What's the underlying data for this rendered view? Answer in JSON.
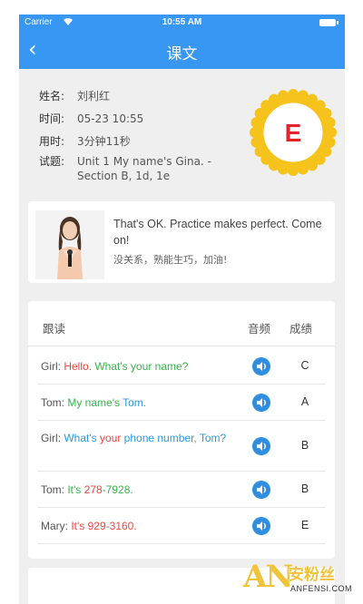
{
  "status_bar": {
    "carrier": "Carrier",
    "wifi_icon": "wifi-icon",
    "time": "10:55 AM",
    "battery_icon": "battery-icon"
  },
  "nav": {
    "back_icon": "chevron-left-icon",
    "back_glyph": "‹",
    "title": "课文"
  },
  "info": {
    "rows": [
      {
        "label": "姓名:",
        "value": "刘利红"
      },
      {
        "label": "时间:",
        "value": "05-23 10:55"
      },
      {
        "label": "用时:",
        "value": "3分钟11秒"
      },
      {
        "label": "试题:",
        "value": "Unit 1 My name's Gina. - Section B, 1d, 1e"
      }
    ],
    "grade_badge": "E"
  },
  "tip": {
    "en": "That's OK. Practice makes perfect. Come on!",
    "cn": "没关系，熟能生巧，加油!"
  },
  "table": {
    "headers": {
      "text": "跟读",
      "audio": "音频",
      "score": "成绩"
    },
    "rows": [
      {
        "speaker": "Girl: ",
        "parts": [
          {
            "t": "Hello. ",
            "c": "red"
          },
          {
            "t": "What's your name?",
            "c": "green"
          }
        ],
        "grade": "C"
      },
      {
        "speaker": "Tom: ",
        "parts": [
          {
            "t": "My name's ",
            "c": "green"
          },
          {
            "t": "Tom.",
            "c": "blue"
          }
        ],
        "grade": "A"
      },
      {
        "speaker": "Girl: ",
        "parts": [
          {
            "t": "What's ",
            "c": "blue"
          },
          {
            "t": "your ",
            "c": "red"
          },
          {
            "t": "phone number, ",
            "c": "blue"
          },
          {
            "t": "Tom?",
            "c": "blue"
          }
        ],
        "grade": "B"
      },
      {
        "speaker": "Tom: ",
        "parts": [
          {
            "t": "It's ",
            "c": "green"
          },
          {
            "t": "278",
            "c": "red"
          },
          {
            "t": "-7928.",
            "c": "green"
          }
        ],
        "grade": "B"
      },
      {
        "speaker": "Mary: ",
        "parts": [
          {
            "t": "It's 929-3160.",
            "c": "red"
          }
        ],
        "grade": "E"
      }
    ],
    "audio_icon": "speaker-icon"
  },
  "watermark": {
    "logo": "AN",
    "cn": "安粉丝",
    "en": "ANFENSI.COM"
  },
  "colors": {
    "primary": "#3797f3",
    "badge_gold": "#f5c31b",
    "badge_letter": "#e5212b",
    "red": "#e5483f",
    "green": "#35b34a",
    "blue": "#2d98dc"
  }
}
